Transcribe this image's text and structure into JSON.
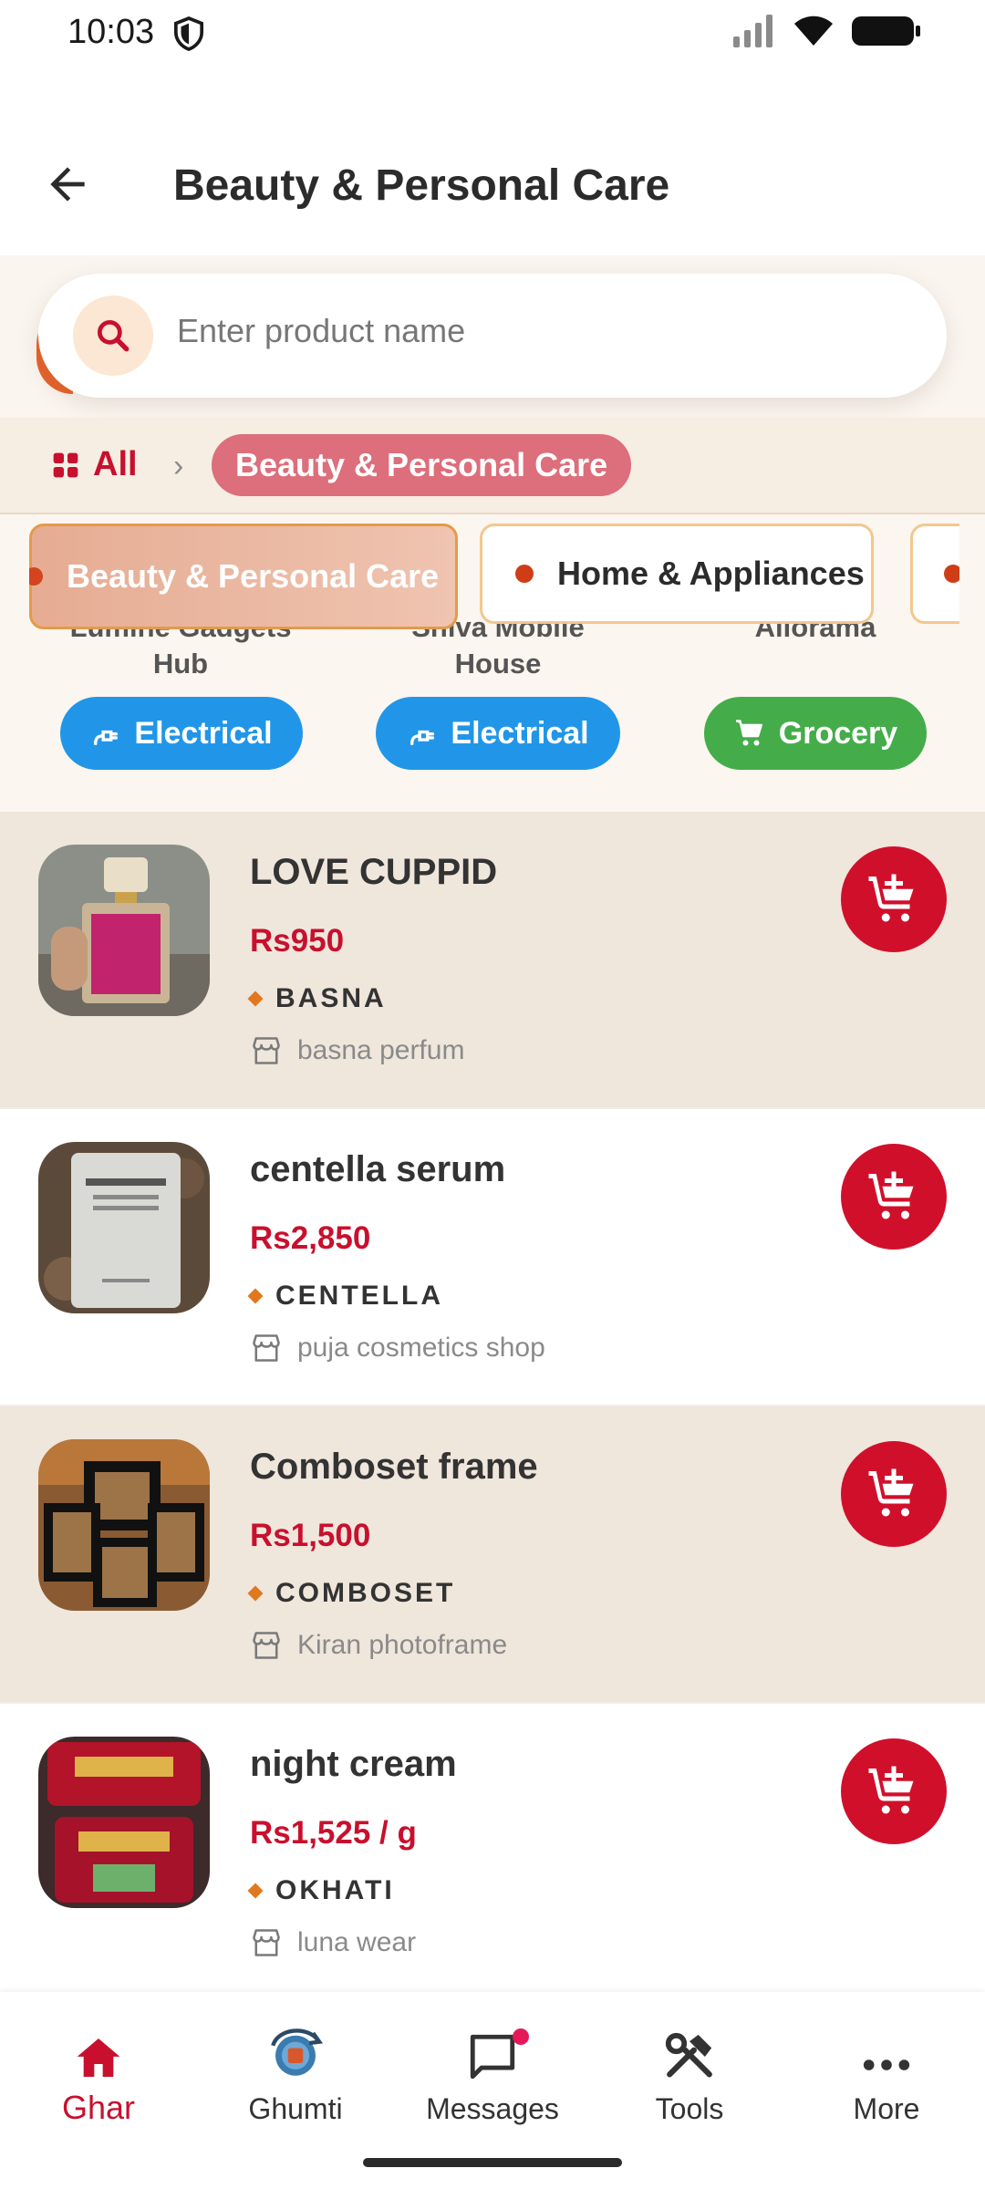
{
  "status_bar": {
    "time": "10:03"
  },
  "header": {
    "title": "Beauty & Personal Care"
  },
  "search": {
    "placeholder": "Enter product name"
  },
  "breadcrumb": {
    "root": "All",
    "current": "Beauty & Personal Care"
  },
  "category_tabs": [
    {
      "label": "Beauty & Personal Care",
      "active": true
    },
    {
      "label": "Home & Appliances",
      "active": false
    },
    {
      "label": "",
      "active": false
    }
  ],
  "shops": [
    {
      "name_line1": "Lumine Gadgets",
      "name_line2": "Hub",
      "category": "Electrical"
    },
    {
      "name_line1": "Shiva Mobile",
      "name_line2": "House",
      "category": "Electrical"
    },
    {
      "name_line1": "Aliorama",
      "name_line2": "",
      "category": "Grocery"
    }
  ],
  "products": [
    {
      "name": "LOVE CUPPID",
      "price": "Rs950",
      "brand": "BASNA",
      "shop": "basna perfum"
    },
    {
      "name": "centella serum",
      "price": "Rs2,850",
      "brand": "CENTELLA",
      "shop": "puja cosmetics shop"
    },
    {
      "name": "Comboset frame",
      "price": "Rs1,500",
      "brand": "COMBOSET",
      "shop": "Kiran photoframe"
    },
    {
      "name": "night cream",
      "price": "Rs1,525 / g",
      "brand": "OKHATI",
      "shop": "luna wear"
    }
  ],
  "bottom_nav": [
    {
      "label": "Ghar",
      "active": true
    },
    {
      "label": "Ghumti",
      "active": false
    },
    {
      "label": "Messages",
      "active": false
    },
    {
      "label": "Tools",
      "active": false
    },
    {
      "label": "More",
      "active": false
    }
  ],
  "colors": {
    "primary": "#c8102e",
    "accent_orange": "#e0781f",
    "electrical": "#2196e8",
    "grocery": "#44ad4a"
  }
}
